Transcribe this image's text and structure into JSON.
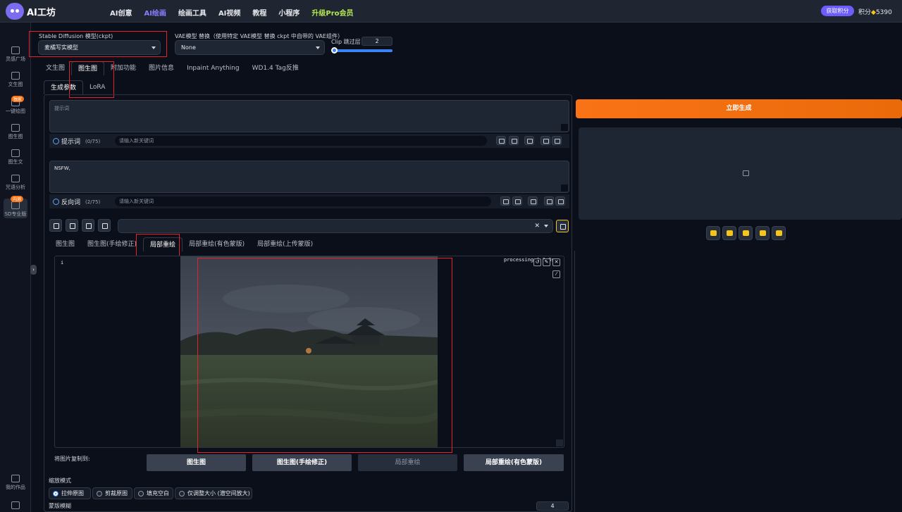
{
  "header": {
    "logo_text": "AI工坊",
    "nav": [
      "AI创意",
      "AI绘画",
      "绘画工具",
      "AI视频",
      "教程",
      "小程序",
      "升级Pro会员"
    ],
    "active_nav": "AI绘画",
    "get_points_label": "获取积分",
    "points_label": "积分",
    "points_value": "5390"
  },
  "sidebar": {
    "items": [
      {
        "label": "灵感广场",
        "icon": "mountain-icon"
      },
      {
        "label": "文生图",
        "icon": "scan-icon"
      },
      {
        "label": "一键绘图",
        "icon": "magic-icon",
        "badge": "独家"
      },
      {
        "label": "图生图",
        "icon": "image-icon"
      },
      {
        "label": "图生文",
        "icon": "image-text-icon"
      },
      {
        "label": "咒语分析",
        "icon": "analysis-icon"
      },
      {
        "label": "SD专业版",
        "icon": "sd-icon",
        "badge": "内测",
        "active": true
      },
      {
        "label": "我的作品",
        "icon": "gallery-icon"
      },
      {
        "label": "",
        "icon": "settings-icon"
      }
    ]
  },
  "model": {
    "checkpoint_label": "Stable Diffusion 模型(ckpt)",
    "checkpoint_value": "麦橘写实模型",
    "vae_label": "VAE模型 替换（使用特定 VAE模型 替换 ckpt 中自带的 VAE组件）",
    "vae_value": "None",
    "clip_label": "Clip 跳过层",
    "clip_value": "2"
  },
  "main_tabs": [
    "文生图",
    "图生图",
    "附加功能",
    "图片信息",
    "Inpaint Anything",
    "WD1.4 Tag反推"
  ],
  "active_main_tab": "图生图",
  "sub_tabs": [
    "生成参数",
    "LoRA"
  ],
  "prompt": {
    "placeholder": "提示词",
    "label": "提示词",
    "count": "(0/75)",
    "keyword_placeholder": "请输入新关键词"
  },
  "negative": {
    "value": "NSFW,",
    "label": "反向词",
    "count": "(2/75)",
    "keyword_placeholder": "请输入新关键词"
  },
  "generate_label": "立即生成",
  "img_tabs": [
    "图生图",
    "图生图(手绘修正)",
    "局部重绘",
    "局部重绘(有色蒙版)",
    "局部重绘(上传蒙版)"
  ],
  "active_img_tab": "局部重绘",
  "canvas": {
    "info_glyph": "i",
    "processing_text": "processing | 0.3s",
    "copy_to_label": "将图片复制到:",
    "copy_buttons": [
      "图生图",
      "图生图(手绘修正)",
      "局部重绘",
      "局部重绘(有色蒙版)"
    ]
  },
  "resize": {
    "label": "缩放模式",
    "options": [
      "拉伸原图",
      "剪裁原图",
      "填充空白",
      "仅调整大小 (潜空间放大)"
    ],
    "selected": "拉伸原图"
  },
  "mask_blur": {
    "label": "蒙版模糊",
    "value": "4"
  }
}
